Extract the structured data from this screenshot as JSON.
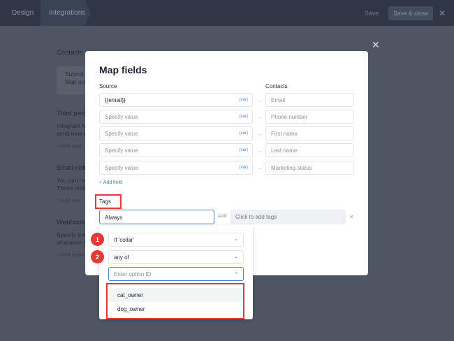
{
  "topbar": {
    "tabs": [
      "Design",
      "Integrations"
    ],
    "save_label": "Save",
    "save_close_label": "Save & close",
    "close_glyph": "✕"
  },
  "background": {
    "contacts_heading": "Contacts",
    "card_line1": "Submit",
    "card_line2": "Map out",
    "third_party_heading": "Third party",
    "third_party_line1": "Integrate for",
    "third_party_line2": "send new em",
    "third_party_link": "+ Add appl",
    "email_heading": "Email notif",
    "email_line1": "You can rece",
    "email_line2": "These notifi",
    "email_link": "+ Add noti",
    "webhooks_heading": "Webhooks",
    "webhooks_line1": "Specify the",
    "webhooks_line2": "whenever yo",
    "webhooks_link": "+ Add webh"
  },
  "modal": {
    "title": "Map fields",
    "close_glyph": "✕",
    "source_label": "Source",
    "contacts_label": "Contacts",
    "var_label": "{var}",
    "arrow_glyph": "→",
    "rows": [
      {
        "source": "{{email}}",
        "source_is_value": true,
        "dest": "Email"
      },
      {
        "source": "Specify value",
        "source_is_value": false,
        "dest": "Phone number"
      },
      {
        "source": "Specify value",
        "source_is_value": false,
        "dest": "First name"
      },
      {
        "source": "Specify value",
        "source_is_value": false,
        "dest": "Last name"
      },
      {
        "source": "Specify value",
        "source_is_value": false,
        "dest": "Marketing status"
      }
    ],
    "add_field": "+ Add field",
    "tags_label": "Tags",
    "tags_select_value": "Always",
    "add_button": "ADD",
    "tag_input_placeholder": "Click to add tags",
    "tag_clear_glyph": "✕"
  },
  "condition": {
    "field_value": "If 'collar'",
    "operator_value": "any of",
    "option_placeholder": "Enter option ID",
    "chevron_down": "⌄",
    "chevron_up": "⌃",
    "options": [
      "cat_owner",
      "dog_owner"
    ],
    "badges": [
      "1",
      "2"
    ]
  },
  "colors": {
    "accent": "#4f7fd9",
    "highlight": "#e53935"
  }
}
